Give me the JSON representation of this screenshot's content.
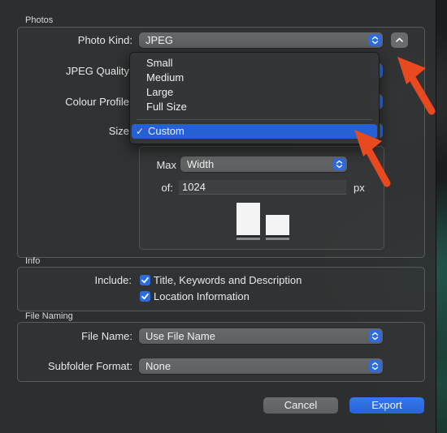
{
  "sections": {
    "photos": "Photos",
    "info": "Info",
    "file_naming": "File Naming"
  },
  "photos": {
    "photo_kind_label": "Photo Kind:",
    "photo_kind_value": "JPEG",
    "jpeg_quality_label": "JPEG Quality",
    "colour_profile_label": "Colour Profile",
    "size_label": "Size",
    "max_label": "Max",
    "max_value": "Width",
    "of_label": "of:",
    "of_value": "1024",
    "px_label": "px"
  },
  "size_menu": {
    "items": [
      "Small",
      "Medium",
      "Large",
      "Full Size"
    ],
    "selected": "Custom",
    "check": "✓"
  },
  "info": {
    "include_label": "Include:",
    "options": [
      {
        "label": "Title, Keywords and Description",
        "checked": true
      },
      {
        "label": "Location Information",
        "checked": true
      }
    ]
  },
  "file_naming": {
    "file_name_label": "File Name:",
    "file_name_value": "Use File Name",
    "subfolder_label": "Subfolder Format:",
    "subfolder_value": "None"
  },
  "buttons": {
    "cancel": "Cancel",
    "export": "Export"
  },
  "colors": {
    "accent": "#2c6ce0",
    "annotation_arrow": "#e8491e"
  },
  "icons": {
    "disclosure": "chevron-up-icon",
    "popup": "up-down-chevron-icon",
    "checkbox": "checkmark-icon"
  }
}
